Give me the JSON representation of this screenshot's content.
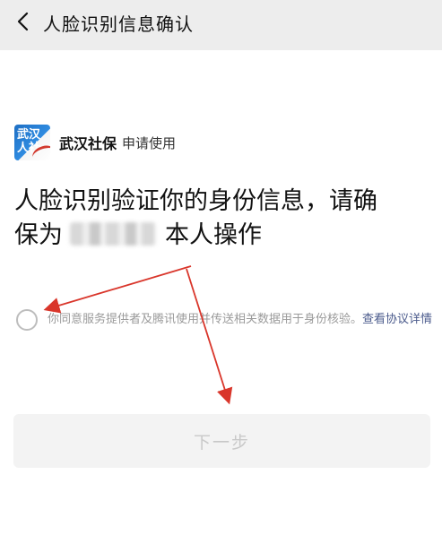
{
  "header": {
    "back_icon": "chevron-left-icon",
    "title": "人脸识别信息确认"
  },
  "app": {
    "logo_text": "武汉人社",
    "name": "武汉社保",
    "apply_text": "申请使用"
  },
  "headline": {
    "line1": "人脸识别验证你的身份信息，请确",
    "line2_prefix": "保为",
    "line2_suffix": "本人操作"
  },
  "agreement": {
    "text": "你同意服务提供者及腾讯使用并传送相关数据用于身份核验。",
    "link": "查看协议详情"
  },
  "next_button": {
    "label": "下一步"
  },
  "colors": {
    "topbar_bg": "#ededed",
    "arrow": "#d9362b",
    "link": "#4b5b8c",
    "disabled_btn_bg": "#f3f3f3"
  }
}
